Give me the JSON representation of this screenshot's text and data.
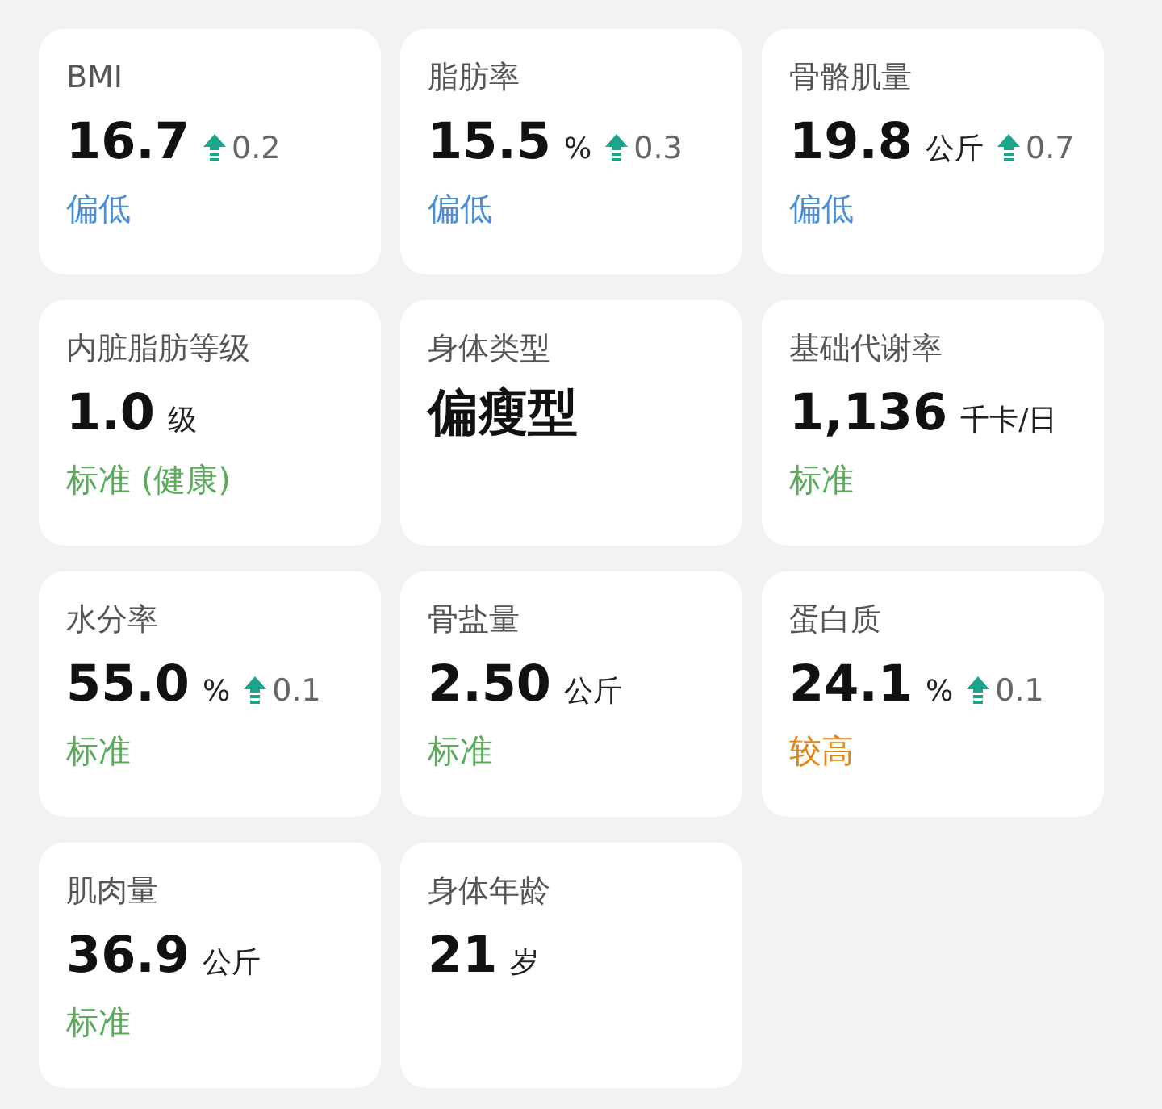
{
  "metrics": [
    {
      "title": "BMI",
      "value": "16.7",
      "change": {
        "kind": "up",
        "text": "0.2"
      },
      "status": {
        "text": "偏低",
        "color": "#4a8fd6"
      }
    },
    {
      "title": "脂肪率",
      "value": "15.5",
      "unit": "%",
      "change": {
        "kind": "up",
        "text": "0.3"
      },
      "status": {
        "text": "偏低",
        "color": "#4a8fd6"
      }
    },
    {
      "title": "骨骼肌量",
      "value": "19.8",
      "unit": "公斤",
      "change": {
        "kind": "up",
        "text": "0.7"
      },
      "status": {
        "text": "偏低",
        "color": "#4a8fd6"
      }
    },
    {
      "title": "内脏脂肪等级",
      "value": "1.0",
      "unit": "级",
      "status": {
        "text": "标准 (健康)",
        "color": "#5aab5a"
      }
    },
    {
      "title": "身体类型",
      "value": "偏瘦型"
    },
    {
      "title": "基础代谢率",
      "value": "1,136",
      "unit": "千卡/日",
      "status": {
        "text": "标准",
        "color": "#5aab5a"
      }
    },
    {
      "title": "水分率",
      "value": "55.0",
      "unit": "%",
      "change": {
        "kind": "up",
        "text": "0.1"
      },
      "status": {
        "text": "标准",
        "color": "#5aab5a"
      }
    },
    {
      "title": "骨盐量",
      "value": "2.50",
      "unit": "公斤",
      "status": {
        "text": "标准",
        "color": "#5aab5a"
      }
    },
    {
      "title": "蛋白质",
      "value": "24.1",
      "unit": "%",
      "change": {
        "kind": "up",
        "text": "0.1"
      },
      "status": {
        "text": "较高",
        "color": "#e0861b"
      }
    },
    {
      "title": "肌肉量",
      "value": "36.9",
      "unit": "公斤",
      "status": {
        "text": "标准",
        "color": "#5aab5a"
      }
    },
    {
      "title": "身体年龄",
      "value": "21",
      "unit": "岁"
    }
  ]
}
